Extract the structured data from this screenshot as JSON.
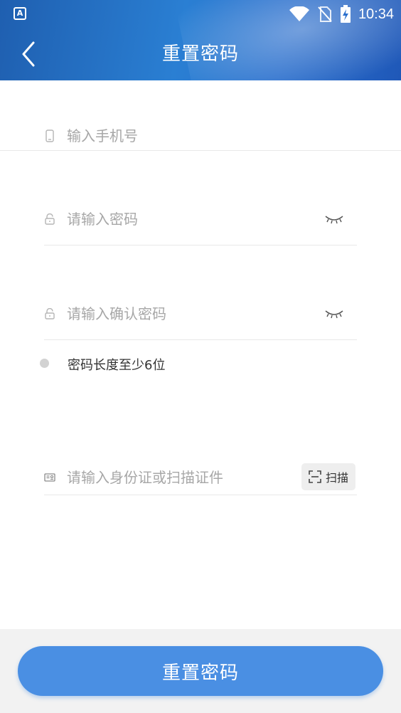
{
  "status_bar": {
    "app_icon_letter": "A",
    "time": "10:34",
    "icons": [
      "wifi-icon",
      "no-sim-icon",
      "battery-charging-icon"
    ]
  },
  "header": {
    "title": "重置密码",
    "back_icon": "chevron-left-icon"
  },
  "form": {
    "phone": {
      "placeholder": "输入手机号",
      "icon": "phone-icon"
    },
    "password": {
      "placeholder": "请输入密码",
      "icon": "lock-icon",
      "toggle_icon": "eye-closed-icon"
    },
    "confirm_password": {
      "placeholder": "请输入确认密码",
      "icon": "lock-icon",
      "toggle_icon": "eye-closed-icon"
    },
    "hint": "密码长度至少6位",
    "id_card": {
      "placeholder": "请输入身份证或扫描证件",
      "icon": "id-card-icon",
      "scan_label": "扫描",
      "scan_icon": "scan-frame-icon"
    }
  },
  "footer": {
    "submit_label": "重置密码"
  },
  "colors": {
    "header_blue": "#2a7fd3",
    "button_blue": "#4a8fe3",
    "placeholder_gray": "#a7a7a7"
  }
}
